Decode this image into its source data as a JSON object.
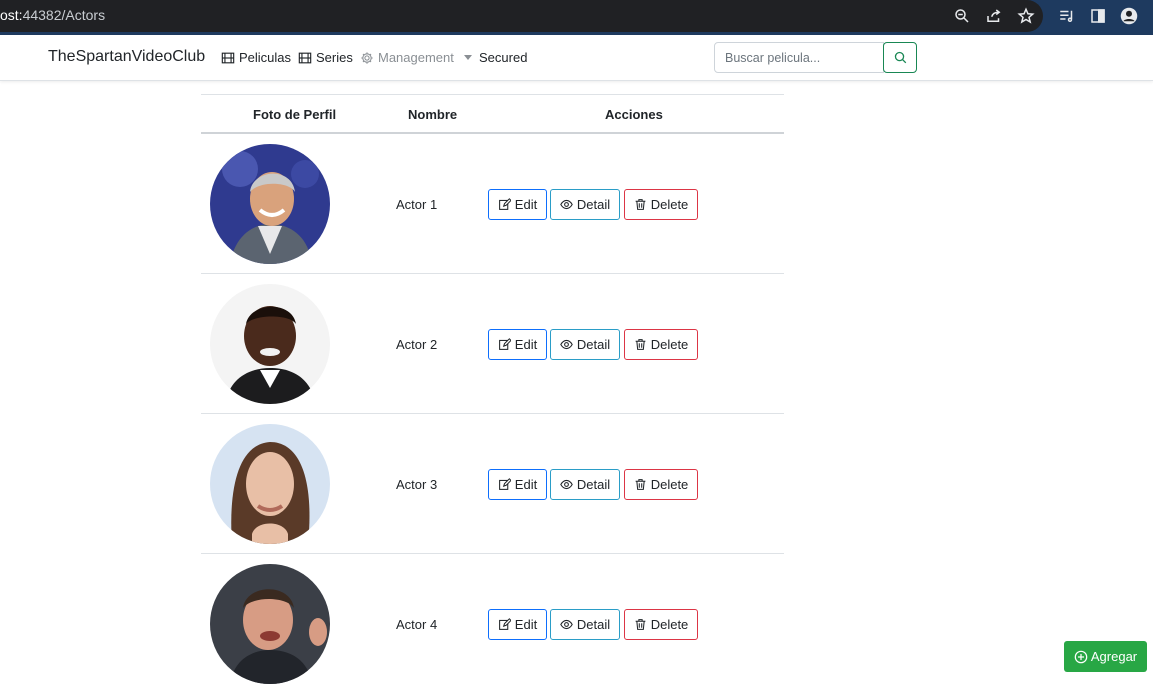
{
  "browser": {
    "url_prefix": "ost:",
    "url_rest": "44382/Actors",
    "icons": [
      "zoom-icon",
      "share-icon",
      "star-icon",
      "media-icon",
      "sidepanel-icon",
      "profile-icon"
    ]
  },
  "navbar": {
    "brand": "TheSpartanVideoClub",
    "items": [
      {
        "label": "Peliculas",
        "icon": "film-icon"
      },
      {
        "label": "Series",
        "icon": "film-icon"
      },
      {
        "label": "Management",
        "icon": "gear-icon"
      },
      {
        "label": "Secured"
      }
    ],
    "search": {
      "placeholder": "Buscar pelicula...",
      "value": ""
    }
  },
  "table": {
    "headers": {
      "photo": "Foto de Perfil",
      "name": "Nombre",
      "actions": "Acciones"
    },
    "rows": [
      {
        "name": "Actor 1",
        "edit": "Edit",
        "detail": "Detail",
        "delete": "Delete"
      },
      {
        "name": "Actor 2",
        "edit": "Edit",
        "detail": "Detail",
        "delete": "Delete"
      },
      {
        "name": "Actor 3",
        "edit": "Edit",
        "detail": "Detail",
        "delete": "Delete"
      },
      {
        "name": "Actor 4",
        "edit": "Edit",
        "detail": "Detail",
        "delete": "Delete"
      }
    ]
  },
  "add_button": {
    "label": "Agregar",
    "icon": "plus-circle-icon"
  },
  "colors": {
    "brand_green": "#198754",
    "add_green": "#28a745",
    "edit_blue": "#0d6efd",
    "detail_cyan": "#2a9dc7",
    "delete_red": "#dc3545"
  }
}
